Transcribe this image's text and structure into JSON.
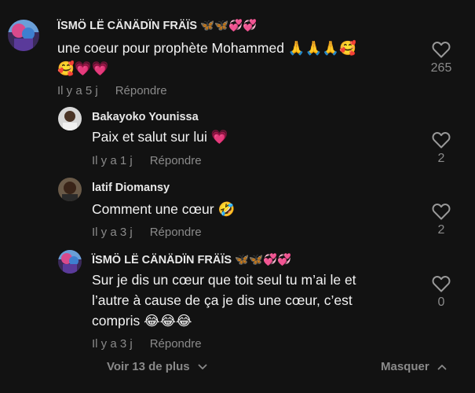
{
  "comments": [
    {
      "author": "ÏSMÖ LË CÄNÄDÏN FRÄÏS 🦋🦋💞💞",
      "line1": "une coeur pour prophète Mohammed 🙏🙏🙏🥰",
      "line2": "🥰💗💗",
      "time": "Il y a 5 j",
      "reply": "Répondre",
      "likes": "265"
    },
    {
      "author": "Bakayoko Younissa",
      "line1": "Paix et salut sur lui 💗",
      "time": "Il y a 1 j",
      "reply": "Répondre",
      "likes": "2"
    },
    {
      "author": "latif Diomansy",
      "line1": "Comment une cœur 🤣",
      "time": "Il y a 3 j",
      "reply": "Répondre",
      "likes": "2"
    },
    {
      "author": "ÏSMÖ LË CÄNÄDÏN FRÄÏS 🦋🦋💞💞",
      "line1": "Sur je dis un cœur que toit seul tu m’ai le et",
      "line2": "l’autre à cause de ça je dis une cœur, c’est",
      "line3": "compris 😂😂😂",
      "time": "Il y a 3 j",
      "reply": "Répondre",
      "likes": "0"
    }
  ],
  "footer": {
    "view_more": "Voir 13 de plus",
    "hide": "Masquer"
  },
  "colors": {
    "background": "#121212",
    "muted": "#8a8a8a",
    "text": "#f2f2f2"
  },
  "icons": [
    "heart-outline-icon",
    "chevron-down-icon",
    "chevron-up-icon"
  ]
}
